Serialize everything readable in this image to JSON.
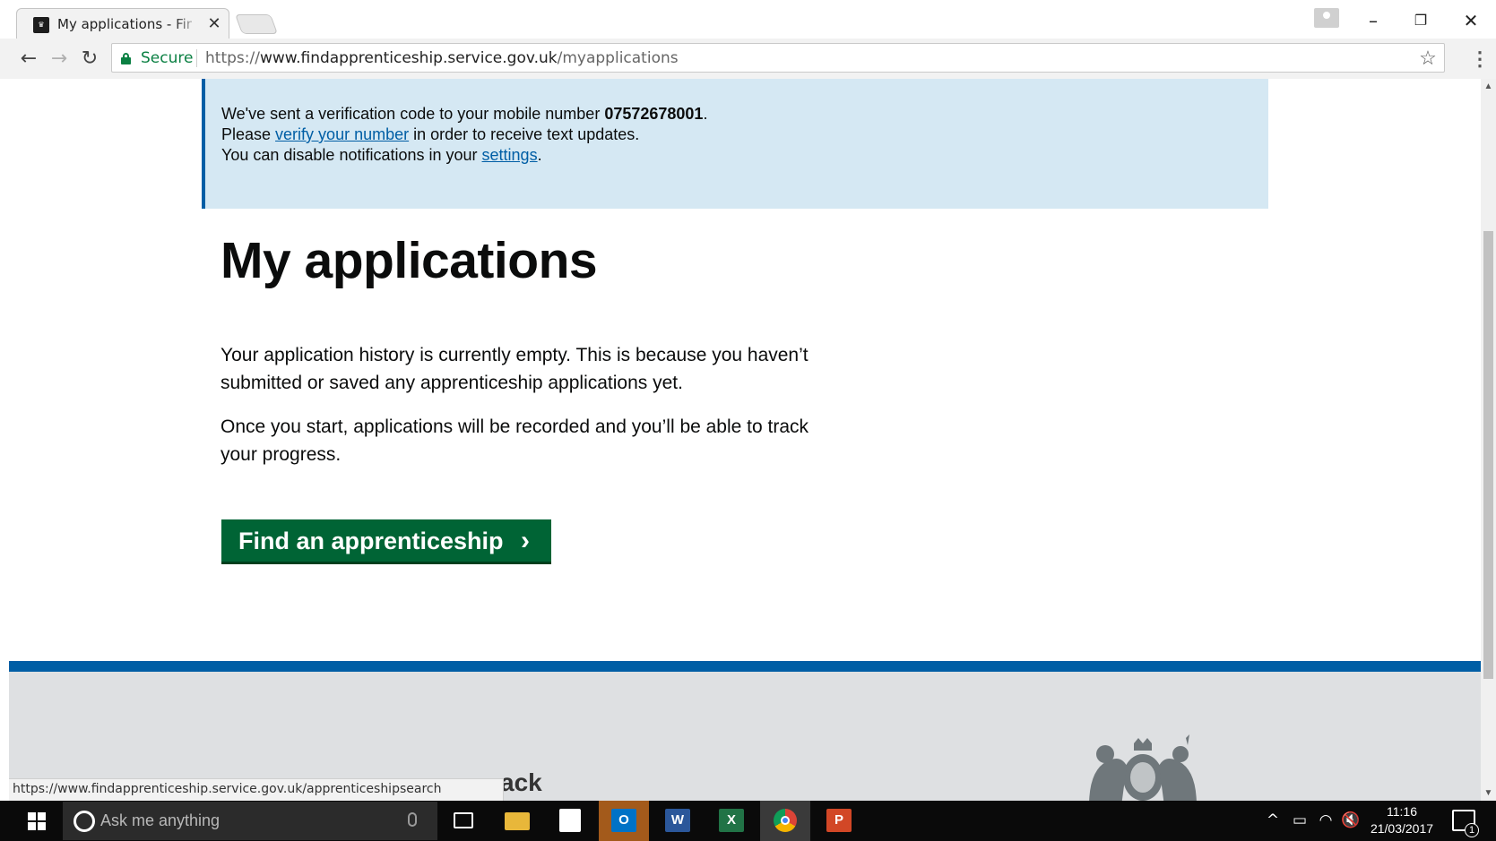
{
  "browser": {
    "tab_title": "My applications - Find an apprenticeship",
    "close_glyph": "✕",
    "secure_label": "Secure",
    "url_scheme": "https://",
    "url_host": "www.findapprenticeship.service.gov.uk",
    "url_path": "/myapplications",
    "status_url": "https://www.findapprenticeship.service.gov.uk/apprenticeshipsearch",
    "security_color": "#0b8043"
  },
  "notice": {
    "line1_prefix": "We've sent a verification code to your mobile number ",
    "mobile_number": "07572678001",
    "line1_suffix": ".",
    "line2_prefix": "Please ",
    "verify_link": "verify your number",
    "line2_suffix": " in order to receive text updates.",
    "line3_prefix": "You can disable notifications in your ",
    "settings_link": "settings",
    "line3_suffix": ".",
    "background_color": "#d5e8f3",
    "link_color": "#005ea5"
  },
  "main": {
    "title": "My applications",
    "para1": "Your application history is currently empty. This is because you haven’t submitted or saved any apprenticeship applications yet.",
    "para2": "Once you start, applications will be recorded and you’ll be able to track your progress.",
    "cta_label": "Find an apprenticeship",
    "cta_color": "#006435"
  },
  "footer": {
    "partial_text": "ack",
    "stripe_color": "#005ea5"
  },
  "taskbar": {
    "search_placeholder": "Ask me anything",
    "apps": [
      {
        "name": "task-view-icon",
        "label": ""
      },
      {
        "name": "file-explorer-icon",
        "label": ""
      },
      {
        "name": "store-icon",
        "label": ""
      },
      {
        "name": "outlook-icon",
        "label": "O"
      },
      {
        "name": "word-icon",
        "label": "W"
      },
      {
        "name": "excel-icon",
        "label": "X"
      },
      {
        "name": "chrome-icon",
        "label": ""
      },
      {
        "name": "powerpoint-icon",
        "label": "P"
      }
    ],
    "time": "11:16",
    "date": "21/03/2017",
    "notification_count": "1"
  }
}
